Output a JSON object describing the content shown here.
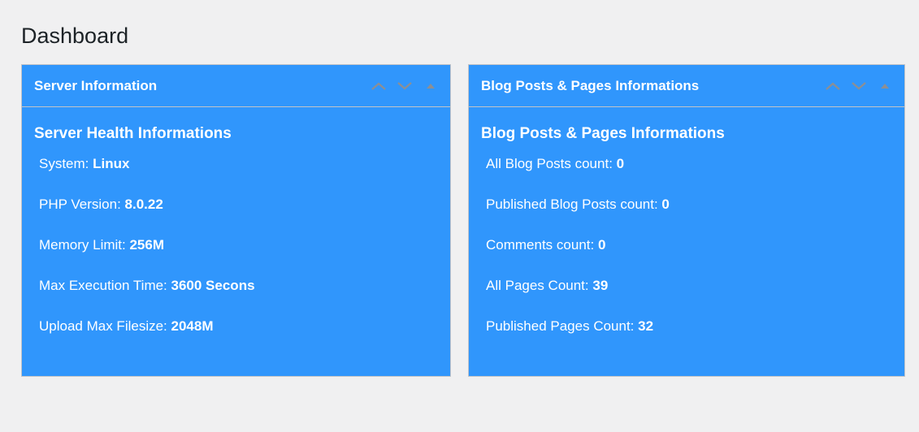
{
  "page": {
    "title": "Dashboard"
  },
  "server_box": {
    "title": "Server Information",
    "heading": "Server Health Informations",
    "items": [
      {
        "label": "System: ",
        "value": "Linux"
      },
      {
        "label": "PHP Version: ",
        "value": "8.0.22"
      },
      {
        "label": "Memory Limit: ",
        "value": "256M"
      },
      {
        "label": "Max Execution Time: ",
        "value": "3600 Secons"
      },
      {
        "label": "Upload Max Filesize: ",
        "value": "2048M"
      }
    ]
  },
  "blog_box": {
    "title": "Blog Posts & Pages Informations",
    "heading": "Blog Posts & Pages Informations",
    "items": [
      {
        "label": "All Blog Posts count: ",
        "value": "0"
      },
      {
        "label": "Published Blog Posts count: ",
        "value": "0"
      },
      {
        "label": "Comments count: ",
        "value": "0"
      },
      {
        "label": "All Pages Count: ",
        "value": "39"
      },
      {
        "label": "Published Pages Count: ",
        "value": "32"
      }
    ]
  },
  "icons": {
    "move_up": "chevron-up-icon",
    "move_down": "chevron-down-icon",
    "toggle": "triangle-up-icon"
  },
  "colors": {
    "page_background": "#f0f0f1",
    "panel_background": "#3096fc",
    "panel_text": "#ffffff",
    "title_text": "#1d2327",
    "handle_icon": "#8c8f94"
  }
}
